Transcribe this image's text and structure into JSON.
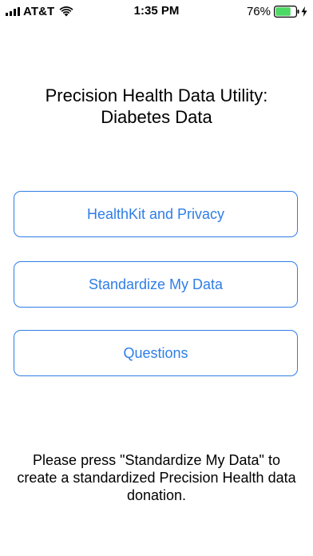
{
  "status_bar": {
    "carrier": "AT&T",
    "time": "1:35 PM",
    "battery_percent": "76%",
    "signal_icon": "cellular-signal-icon",
    "wifi_icon": "wifi-icon",
    "battery_icon": "battery-icon",
    "charging_icon": "charging-bolt-icon",
    "battery_level": 0.76,
    "battery_color": "#4cd964"
  },
  "main": {
    "title": "Precision Health Data Utility:\nDiabetes Data",
    "buttons": [
      {
        "label": "HealthKit and Privacy"
      },
      {
        "label": "Standardize My Data"
      },
      {
        "label": "Questions"
      }
    ],
    "instructions": "Please press \"Standardize My Data\" to create a standardized Precision Health data donation."
  },
  "colors": {
    "accent": "#2f7ee6",
    "background": "#ffffff",
    "text": "#000000"
  }
}
